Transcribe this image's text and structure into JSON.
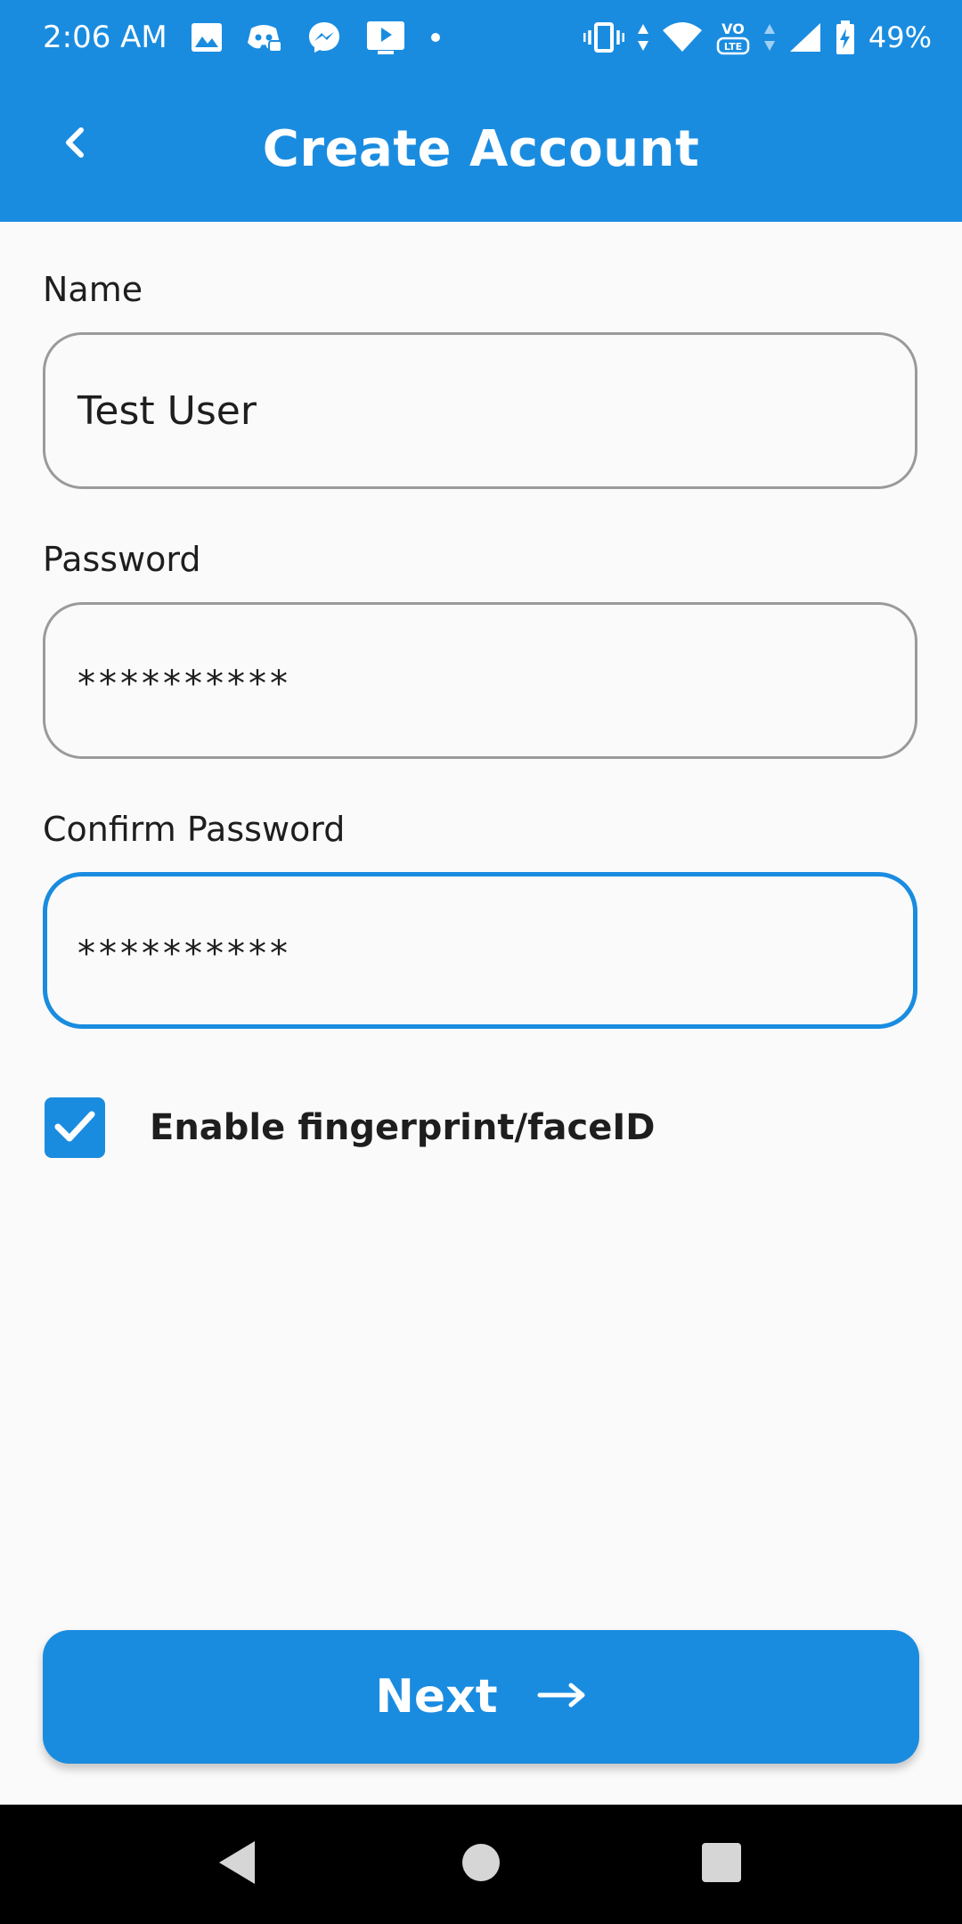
{
  "status_bar": {
    "time": "2:06 AM",
    "battery_percent": "49%",
    "icons_left": [
      "gallery-icon",
      "discord-icon",
      "messenger-icon",
      "screencast-icon",
      "dot-icon"
    ],
    "icons_right": [
      "vibrate-icon",
      "data-arrows-icon",
      "wifi-icon",
      "volte-icon",
      "data-arrows-icon",
      "cell-signal-icon",
      "battery-charging-icon"
    ]
  },
  "app_bar": {
    "title": "Create Account",
    "back_icon": "chevron-left-icon"
  },
  "form": {
    "name": {
      "label": "Name",
      "value": "Test User"
    },
    "password": {
      "label": "Password",
      "value": "**********"
    },
    "confirm_password": {
      "label": "Confirm Password",
      "value": "**********",
      "focused": true
    },
    "biometric": {
      "label": "Enable fingerprint/faceID",
      "checked": true
    }
  },
  "actions": {
    "next_label": "Next",
    "next_icon": "arrow-right-icon"
  },
  "nav_bar": {
    "buttons": [
      "back-triangle-icon",
      "home-circle-icon",
      "recents-square-icon"
    ]
  },
  "colors": {
    "primary": "#1a8ce0",
    "background": "#fafafa",
    "text": "#1e1e1e",
    "field_border": "#9a9a9a",
    "nav_bar": "#000000"
  }
}
